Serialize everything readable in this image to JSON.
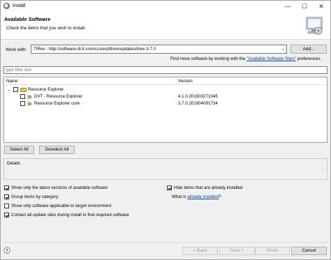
{
  "window": {
    "title": "Install"
  },
  "window_controls": {
    "minimize": "—",
    "maximize": "☐",
    "close": "✕"
  },
  "banner": {
    "heading": "Available Software",
    "subtitle": "Check the items that you wish to install."
  },
  "work_with": {
    "label": "Work with:",
    "value": "TIRex - http://software-dl.ti.com/ccs/esd/tirex/updates/tirex-3.7.0",
    "add_label": "Add..."
  },
  "hint": {
    "prefix": "Find more software by working with the ",
    "link": "\"Available Software Sites\"",
    "suffix": " preferences."
  },
  "filter": {
    "placeholder": "type filter text"
  },
  "table": {
    "columns": {
      "name": "Name",
      "version": "Version"
    },
    "rows": [
      {
        "name": "Resource Explorer",
        "version": ""
      },
      {
        "name": "DVT - Resource Explorer",
        "version": "4.1.0.201903271045"
      },
      {
        "name": "Resource Explorer core",
        "version": "3.7.0.201904091734"
      }
    ]
  },
  "selection": {
    "select_all": "Select All",
    "deselect_all": "Deselect All"
  },
  "details": {
    "label": "Details"
  },
  "options": {
    "latest_versions": {
      "label": "Show only the latest versions of available software",
      "checked": true
    },
    "group_by_category": {
      "label": "Group items by category",
      "checked": true
    },
    "target_env": {
      "label": "Show only software applicable to target environment",
      "checked": false
    },
    "contact_sites": {
      "label": "Contact all update sites during install to find required software",
      "checked": true
    },
    "hide_installed": {
      "label": "Hide items that are already installed",
      "checked": true
    },
    "what_is": {
      "prefix": "What is ",
      "link": "already installed",
      "suffix": "?"
    }
  },
  "footer": {
    "help": "?",
    "back": "< Back",
    "next": "Next >",
    "finish": "Finish",
    "cancel": "Cancel"
  },
  "icons": {
    "tree_toggle": "⌄",
    "combo_arrow": "⌄",
    "details_scroll": "⌃"
  }
}
